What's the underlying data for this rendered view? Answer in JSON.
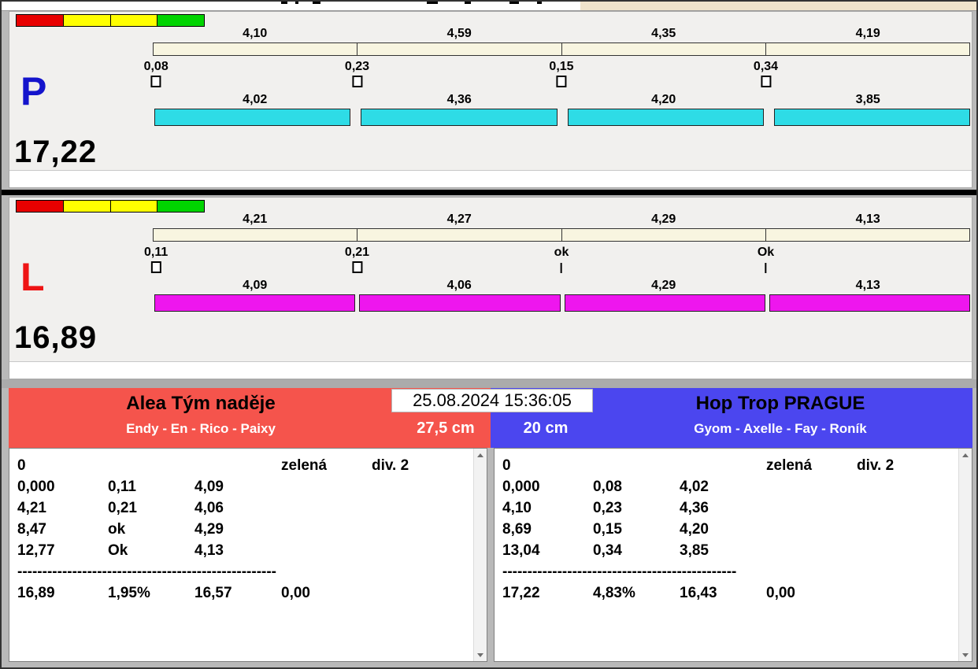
{
  "window": {
    "top_right_color": "#f0e3cb"
  },
  "status_strip": {
    "colors": [
      "#e80000",
      "#ffff00",
      "#ffff00",
      "#00d400"
    ]
  },
  "datetime": "25.08.2024 15:36:05",
  "lanes": [
    {
      "letter": "P",
      "letter_color": "#1414cc",
      "total": "17,22",
      "bar_color": "#2edce6",
      "segments": [
        {
          "top": "4,10",
          "change": "0,08",
          "marker": "box",
          "bottom": "4,02"
        },
        {
          "top": "4,59",
          "change": "0,23",
          "marker": "box",
          "bottom": "4,36"
        },
        {
          "top": "4,35",
          "change": "0,15",
          "marker": "box",
          "bottom": "4,20"
        },
        {
          "top": "4,19",
          "change": "0,34",
          "marker": "box",
          "bottom": "3,85"
        }
      ]
    },
    {
      "letter": "L",
      "letter_color": "#ee1414",
      "total": "16,89",
      "bar_color": "#ee16ee",
      "segments": [
        {
          "top": "4,21",
          "change": "0,11",
          "marker": "box",
          "bottom": "4,09"
        },
        {
          "top": "4,27",
          "change": "0,21",
          "marker": "box",
          "bottom": "4,06"
        },
        {
          "top": "4,29",
          "change": "ok",
          "marker": "tick",
          "bottom": "4,29"
        },
        {
          "top": "4,13",
          "change": "Ok",
          "marker": "tick",
          "bottom": "4,13"
        }
      ]
    }
  ],
  "teams": [
    {
      "name": "Alea Tým naděje",
      "members": "Endy - En - Rico - Paixy",
      "category": "27,5 cm",
      "header_color": "#f5544c",
      "log": {
        "status": "0",
        "flag": "zelená",
        "division": "div. 2",
        "rows": [
          {
            "c1": "0,000",
            "c2": "0,11",
            "c3": "4,09"
          },
          {
            "c1": "4,21",
            "c2": "0,21",
            "c3": "4,06"
          },
          {
            "c1": "8,47",
            "c2": "ok",
            "c3": "4,29"
          },
          {
            "c1": "12,77",
            "c2": "Ok",
            "c3": "4,13"
          }
        ],
        "divider": "----------------------------------------------------",
        "summary": {
          "total": "16,89",
          "pct": "1,95%",
          "net": "16,57",
          "penalty": "0,00"
        }
      }
    },
    {
      "name": "Hop Trop PRAGUE",
      "members": "Gyom - Axelle - Fay - Roník",
      "category": "20 cm",
      "header_color": "#4b46ef",
      "log": {
        "status": "0",
        "flag": "zelená",
        "division": "div. 2",
        "rows": [
          {
            "c1": "0,000",
            "c2": "0,08",
            "c3": "4,02"
          },
          {
            "c1": "4,10",
            "c2": "0,23",
            "c3": "4,36"
          },
          {
            "c1": "8,69",
            "c2": "0,15",
            "c3": "4,20"
          },
          {
            "c1": "13,04",
            "c2": "0,34",
            "c3": "3,85"
          }
        ],
        "divider": "-----------------------------------------------",
        "summary": {
          "total": "17,22",
          "pct": "4,83%",
          "net": "16,43",
          "penalty": "0,00"
        }
      }
    }
  ]
}
